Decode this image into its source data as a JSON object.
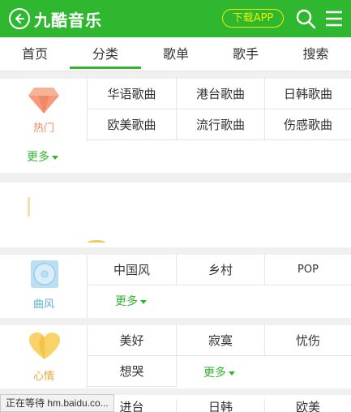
{
  "header": {
    "title": "九酷音乐",
    "download_label": "下载APP",
    "icons": {
      "back": "back-arrow-icon",
      "search": "search-icon",
      "menu": "menu-icon"
    }
  },
  "tabs": [
    {
      "label": "首页"
    },
    {
      "label": "分类"
    },
    {
      "label": "歌单"
    },
    {
      "label": "歌手"
    },
    {
      "label": "搜索"
    }
  ],
  "sections": {
    "hot": {
      "label": "热门",
      "icon": "diamond-icon",
      "items": [
        "华语歌曲",
        "港台歌曲",
        "日韩歌曲",
        "欧美歌曲",
        "流行歌曲",
        "伤感歌曲"
      ],
      "more": "更多"
    },
    "style": {
      "label": "曲风",
      "icon": "disc-icon",
      "items": [
        "中国风",
        "乡村",
        "POP"
      ],
      "more": "更多"
    },
    "mood": {
      "label": "心情",
      "icon": "heart-icon",
      "items": [
        "美好",
        "寂寞",
        "忧伤",
        "想哭"
      ],
      "more": "更多"
    },
    "bottom": {
      "items": [
        "进台",
        "日韩",
        "欧美"
      ]
    }
  },
  "status_bar": {
    "text": "正在等待 hm.baidu.co..."
  },
  "colors": {
    "brand": "#2fb72f",
    "download": "#e8f000",
    "more": "#2fb72f"
  }
}
